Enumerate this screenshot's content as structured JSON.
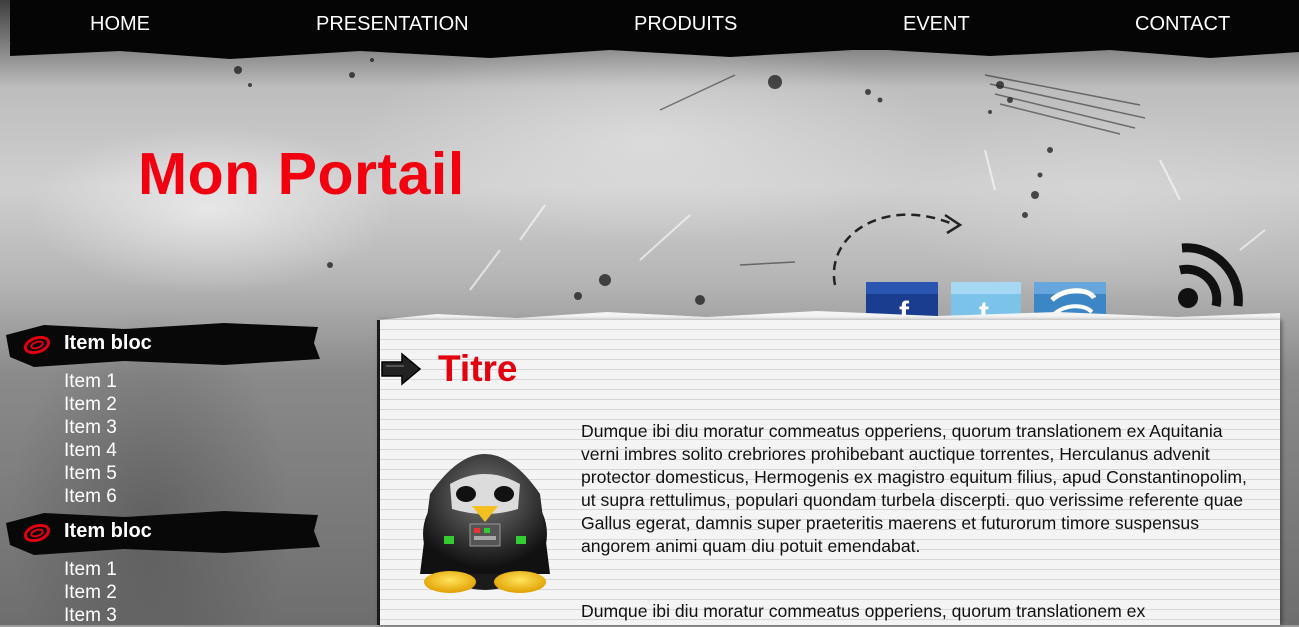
{
  "nav": {
    "items": [
      {
        "label": "HOME"
      },
      {
        "label": "PRESENTATION"
      },
      {
        "label": "PRODUITS"
      },
      {
        "label": "EVENT"
      },
      {
        "label": "CONTACT"
      }
    ]
  },
  "site": {
    "title": "Mon Portail",
    "title_color": "#f2000f"
  },
  "social": {
    "icons": [
      "facebook-icon",
      "twitter-icon",
      "myspace-icon",
      "rss-icon"
    ]
  },
  "sidebar": {
    "blocs": [
      {
        "title": "Item bloc",
        "items": [
          "Item 1",
          "Item 2",
          "Item 3",
          "Item 4",
          "Item 5",
          "Item 6"
        ]
      },
      {
        "title": "Item bloc",
        "items": [
          "Item 1",
          "Item 2",
          "Item 3"
        ]
      }
    ]
  },
  "content": {
    "title": "Titre",
    "title_color": "#e3000f",
    "paragraphs": [
      "Dumque ibi diu moratur commeatus opperiens, quorum translationem ex Aquitania verni imbres solito crebriores prohibebant auctique torrentes, Herculanus advenit protector domesticus, Hermogenis ex magistro equitum filius, apud Constantinopolim, ut supra rettulimus, populari quondam turbela discerpti. quo verissime referente quae Gallus egerat, damnis super praeteritis maerens et futurorum timore suspensus angorem animi quam diu potuit emendabat.",
      "Dumque ibi diu moratur commeatus opperiens, quorum translationem ex"
    ]
  }
}
